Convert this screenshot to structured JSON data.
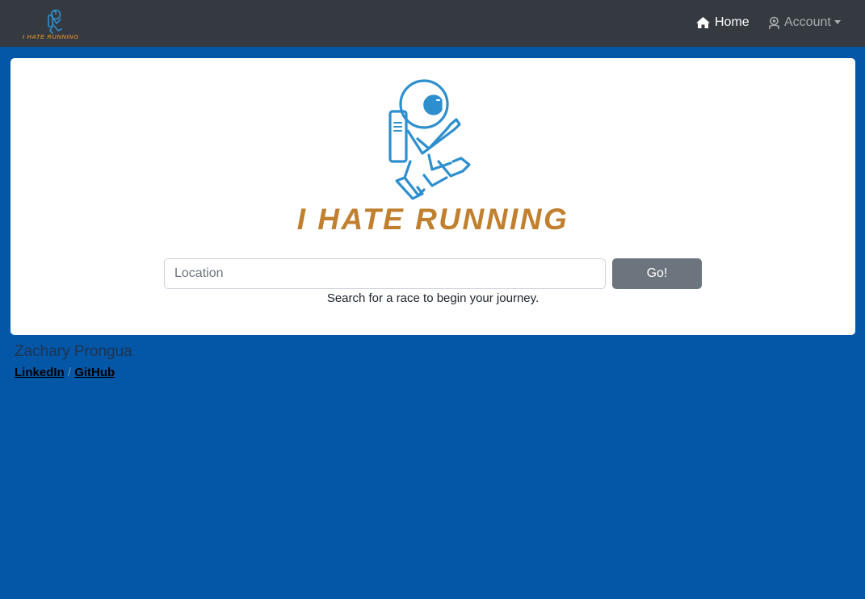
{
  "brand": {
    "name": "I HATE RUNNING",
    "accent_color": "#c08030",
    "icon_color": "#2e8fcf"
  },
  "nav": {
    "home_label": "Home",
    "home_icon": "house-icon",
    "account_label": "Account",
    "account_icon": "user-badge-icon"
  },
  "search": {
    "placeholder": "Location",
    "button_label": "Go!",
    "help_text": "Search for a race to begin your journey."
  },
  "footer": {
    "author": "Zachary Prongua",
    "linkedin_label": "LinkedIn",
    "separator": "/",
    "github_label": " GitHub"
  },
  "colors": {
    "page_background": "#0456a6",
    "navbar_background": "#343a40",
    "button_secondary": "#6c757d"
  }
}
